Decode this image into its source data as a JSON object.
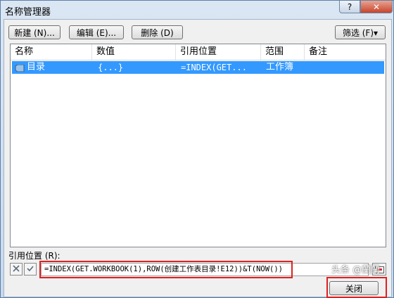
{
  "window": {
    "title": "名称管理器",
    "help_label": "?",
    "close_label": "✕"
  },
  "toolbar": {
    "new_label": "新建 (N)...",
    "edit_label": "编辑 (E)...",
    "delete_label": "删除 (D)",
    "filter_label": "筛选 (F)▾"
  },
  "table": {
    "columns": [
      "名称",
      "数值",
      "引用位置",
      "范围",
      "备注"
    ],
    "rows": [
      {
        "name": "目录",
        "value": "{...}",
        "refers_to": "=INDEX(GET...",
        "scope": "工作簿",
        "comment": ""
      }
    ]
  },
  "refers_to": {
    "label": "引用位置 (R):",
    "value": "=INDEX(GET.WORKBOOK(1),ROW(创建工作表目录!E12))&T(NOW())"
  },
  "footer": {
    "close_label": "关闭"
  },
  "watermark": "头条 @蘭蘭"
}
